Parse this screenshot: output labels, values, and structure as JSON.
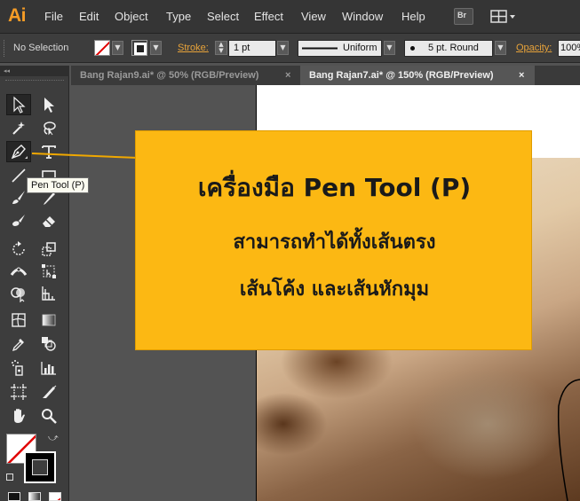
{
  "app": {
    "logo": "Ai"
  },
  "menu": [
    "File",
    "Edit",
    "Object",
    "Type",
    "Select",
    "Effect",
    "View",
    "Window",
    "Help"
  ],
  "menubar_buttons": {
    "bridge": "Br"
  },
  "control": {
    "selection": "No Selection",
    "stroke_label": "Stroke:",
    "stroke_value": "1 pt",
    "profile": "Uniform",
    "brush": "5 pt. Round",
    "opacity_label": "Opacity:",
    "opacity_value": "100%"
  },
  "tabs": [
    {
      "label": "Bang Rajan9.ai* @ 50% (RGB/Preview)",
      "close": "×",
      "active": false
    },
    {
      "label": "Bang Rajan7.ai* @ 150% (RGB/Preview)",
      "close": "×",
      "active": true
    }
  ],
  "tools_panel": {
    "collapse": "◂◂"
  },
  "tooltip": "Pen Tool (P)",
  "callout": {
    "title": "เครื่องมือ Pen Tool (P)",
    "line1": "สามารถทำได้ทั้งเส้นตรง",
    "line2": "เส้นโค้ง และเส้นหักมุม"
  },
  "colors": {
    "accent": "#f59c26",
    "callout_bg": "#fcb813",
    "stroke_link": "#e8a33a",
    "panel_bg": "#3d3d3d",
    "canvas_bg": "#535353"
  },
  "icons": [
    "selection-tool-icon",
    "direct-selection-tool-icon",
    "magic-wand-icon",
    "lasso-icon",
    "pen-tool-icon",
    "type-tool-icon",
    "line-segment-icon",
    "rectangle-icon",
    "paintbrush-icon",
    "pencil-icon",
    "blob-brush-icon",
    "eraser-icon",
    "rotate-icon",
    "scale-icon",
    "width-tool-icon",
    "free-transform-icon",
    "shape-builder-icon",
    "perspective-grid-icon",
    "mesh-icon",
    "gradient-icon",
    "eyedropper-icon",
    "blend-icon",
    "symbol-sprayer-icon",
    "column-graph-icon",
    "artboard-icon",
    "slice-icon",
    "hand-icon",
    "zoom-icon"
  ]
}
